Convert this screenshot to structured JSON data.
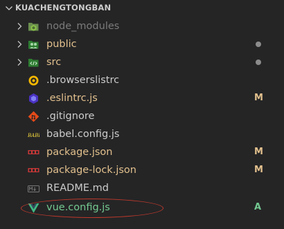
{
  "explorer": {
    "section_title": "KUACHENGTONGBAN",
    "items": [
      {
        "label": "node_modules",
        "icon": "node-modules-folder-icon",
        "status": "",
        "color": "#7b7b7b"
      },
      {
        "label": "public",
        "icon": "public-folder-icon",
        "status": "dot",
        "color": "#e2c08d"
      },
      {
        "label": "src",
        "icon": "src-folder-icon",
        "status": "dot",
        "color": "#e2c08d"
      },
      {
        "label": ".browserslistrc",
        "icon": "browserslist-icon",
        "status": "",
        "color": "#cccccc"
      },
      {
        "label": ".eslintrc.js",
        "icon": "eslint-icon",
        "status": "M",
        "color": "#e2c08d"
      },
      {
        "label": ".gitignore",
        "icon": "git-icon",
        "status": "",
        "color": "#cccccc"
      },
      {
        "label": "babel.config.js",
        "icon": "babel-icon",
        "status": "",
        "color": "#cccccc"
      },
      {
        "label": "package.json",
        "icon": "npm-icon",
        "status": "M",
        "color": "#e2c08d"
      },
      {
        "label": "package-lock.json",
        "icon": "npm-icon",
        "status": "M",
        "color": "#e2c08d"
      },
      {
        "label": "README.md",
        "icon": "markdown-icon",
        "status": "",
        "color": "#cccccc"
      },
      {
        "label": "vue.config.js",
        "icon": "vue-icon",
        "status": "A",
        "color": "#73c991"
      }
    ]
  }
}
